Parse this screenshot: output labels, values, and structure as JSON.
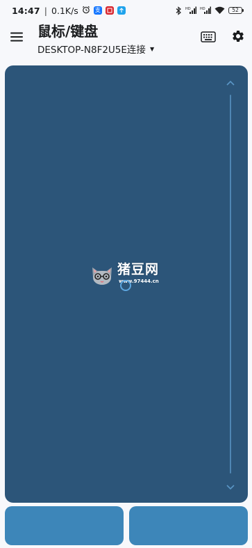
{
  "status_bar": {
    "time": "14:47",
    "network_speed": "0.1K/s",
    "battery_level": "52",
    "notification_icons": [
      "alarm-icon",
      "alipay-icon",
      "app-red-icon",
      "app-blue-icon"
    ],
    "system_icons": [
      "bluetooth-icon",
      "signal-hd-1-icon",
      "signal-hd-2-icon",
      "wifi-icon",
      "battery-icon"
    ]
  },
  "app_bar": {
    "title": "鼠标/键盘",
    "connection_label": "DESKTOP-N8F2U5E连接",
    "dropdown_icon": "triangle-down-icon",
    "menu_icon": "hamburger-menu-icon",
    "keyboard_icon": "keyboard-icon",
    "settings_icon": "gear-icon"
  },
  "touchpad": {
    "scroll_up_icon": "chevron-up-icon",
    "scroll_down_icon": "chevron-down-icon",
    "watermark_text": "猪豆网",
    "watermark_url": "www.97444.cn"
  },
  "colors": {
    "background": "#f7f8fb",
    "touchpad": "#2c5579",
    "scroll_track": "#4f86b3",
    "button": "#3d86b9",
    "cursor_ring": "#5da6df"
  }
}
